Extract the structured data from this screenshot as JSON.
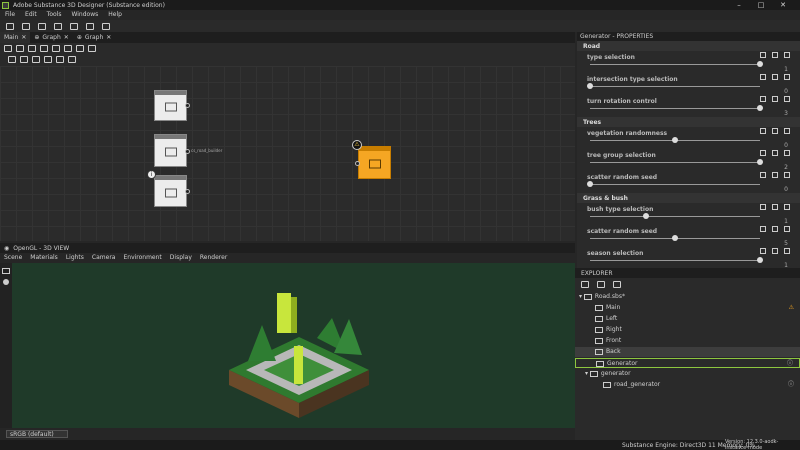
{
  "window": {
    "title": "Adobe Substance 3D Designer (Substance edition)"
  },
  "menu": [
    "File",
    "Edit",
    "Tools",
    "Windows",
    "Help"
  ],
  "tabs": [
    {
      "label": "Main"
    },
    {
      "label": "Graph"
    },
    {
      "label": "Graph"
    }
  ],
  "graph": {
    "connection_label": "cs_road_builder"
  },
  "view3d": {
    "title": "OpenGL - 3D VIEW",
    "menu": [
      "Scene",
      "Materials",
      "Lights",
      "Camera",
      "Environment",
      "Display",
      "Renderer"
    ],
    "colorspace": "sRGB (default)"
  },
  "properties": {
    "title": "Generator - PROPERTIES",
    "sections": [
      {
        "name": "Road",
        "params": [
          {
            "label": "type selection",
            "value": "1",
            "fraction": 1.0
          },
          {
            "label": "intersection type selection",
            "value": "0",
            "fraction": 0.0
          },
          {
            "label": "turn rotation control",
            "value": "3",
            "fraction": 1.0
          }
        ]
      },
      {
        "name": "Trees",
        "params": [
          {
            "label": "vegetation randomness",
            "value": "0",
            "fraction": 0.5
          },
          {
            "label": "tree group selection",
            "value": "2",
            "fraction": 1.0
          },
          {
            "label": "scatter random seed",
            "value": "0",
            "fraction": 0.0
          }
        ]
      },
      {
        "name": "Grass & bush",
        "params": [
          {
            "label": "bush type selection",
            "value": "1",
            "fraction": 0.33
          },
          {
            "label": "scatter random seed",
            "value": "5",
            "fraction": 0.5
          },
          {
            "label": "season selection",
            "value": "1",
            "fraction": 1.0
          }
        ]
      }
    ]
  },
  "explorer": {
    "title": "EXPLORER",
    "package": "Road.sbs*",
    "graphs": [
      "Main",
      "Left",
      "Right",
      "Front",
      "Back",
      "Generator"
    ],
    "folder": "generator",
    "sub": "road_generator"
  },
  "status": {
    "engine": "Substance Engine: Direct3D 11  Memory: 0%",
    "version": "Version: 12.3.0-aodk-instance-mode"
  },
  "colors": {
    "accent": "#f5a623",
    "selected": "#8dc63f"
  }
}
